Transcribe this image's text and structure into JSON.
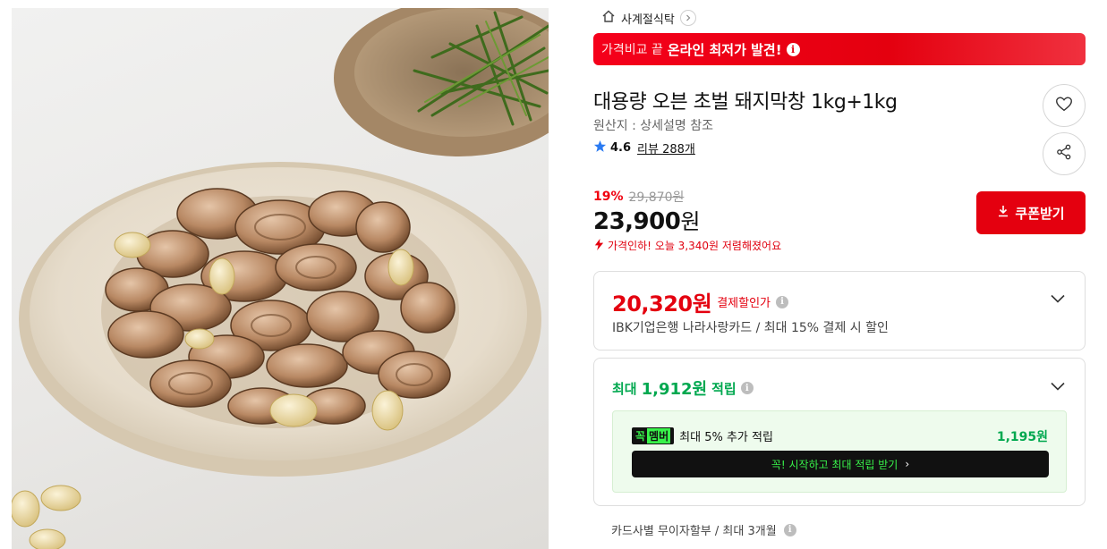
{
  "product_image": {
    "alt_icon": "product-photo"
  },
  "store": {
    "name": "사계절식탁",
    "home_icon": "home-icon",
    "chevron_icon": "chevron-right-icon"
  },
  "banner": {
    "prefix": "가격비교 끝",
    "highlight": "온라인 최저가 발견!",
    "info": "i"
  },
  "product": {
    "title": "대용량 오븐 초벌 돼지막창 1kg+1kg",
    "origin": "원산지 : 상세설명 참조",
    "rating": "4.6",
    "reviews": "리뷰 288개"
  },
  "price": {
    "discount_rate": "19%",
    "original": "29,870원",
    "sale_number": "23,900",
    "sale_unit": "원",
    "drop_notice": "가격인하! 오늘 3,340원 저렴해졌어요"
  },
  "coupon": {
    "label": "쿠폰받기"
  },
  "payment": {
    "price": "20,320원",
    "label": "결제할인가",
    "desc": "IBK기업은행 나라사랑카드 / 최대 15% 결제 시 할인"
  },
  "points": {
    "prefix": "최대",
    "amount": "1,912원",
    "suffix": "적립",
    "member_badge_left": "꼭",
    "member_badge_right": "멤버",
    "member_text": "최대 5% 추가 적립",
    "member_amount": "1,195원",
    "cta": "꼭! 시작하고 최대 적립 받기",
    "cta_arrow": "›"
  },
  "installment": {
    "text": "카드사별 무이자할부 / 최대 3개월"
  },
  "colors": {
    "accent_red": "#e4000f",
    "points_green": "#00a84f",
    "member_lime": "#38f24a",
    "star_blue": "#2b7bf2"
  }
}
